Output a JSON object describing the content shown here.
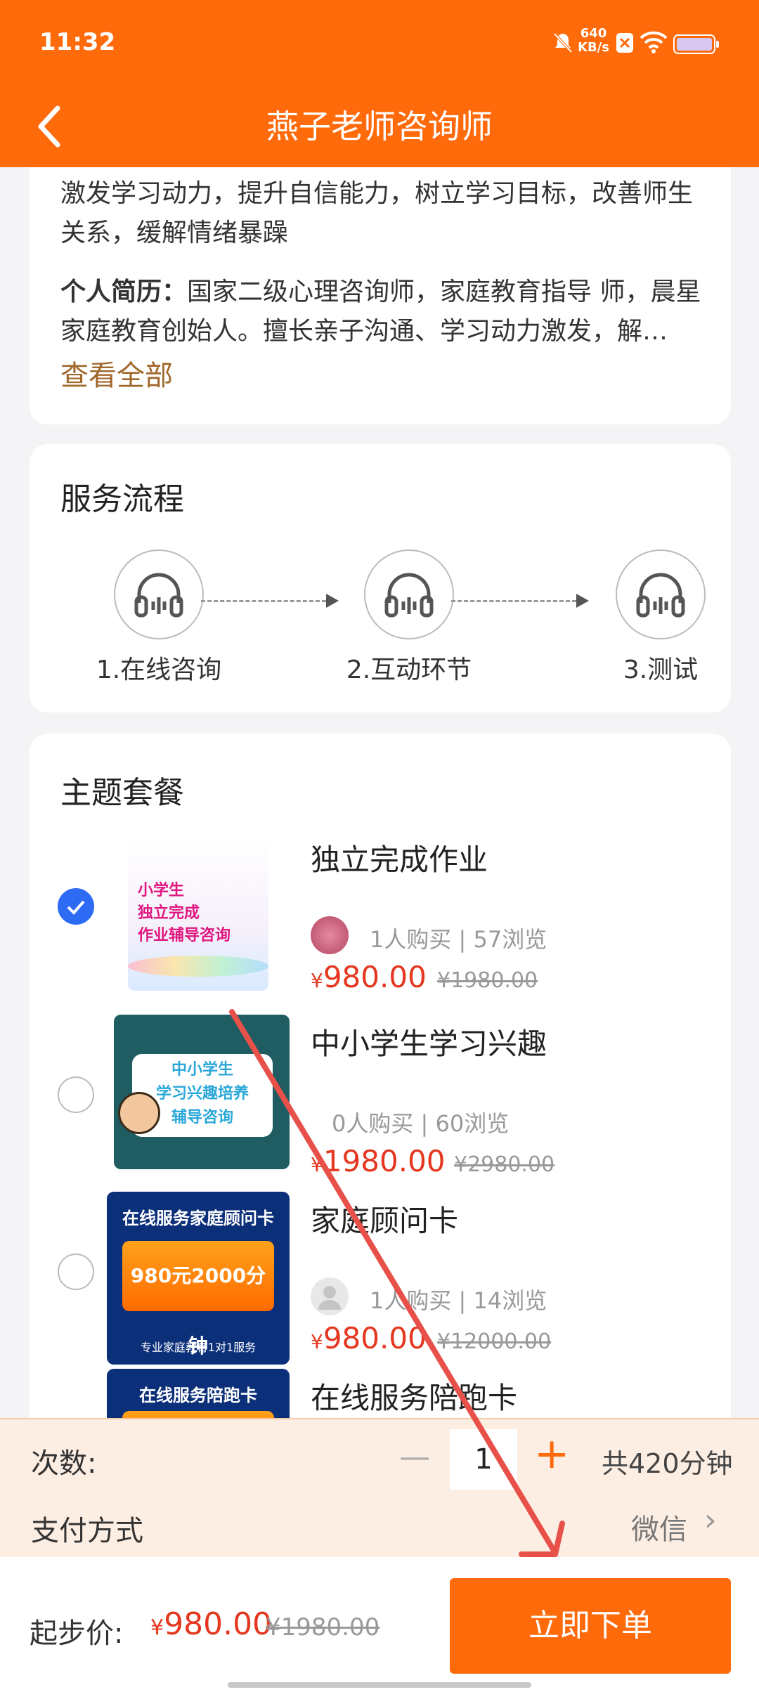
{
  "status_bar": {
    "time": "11:32",
    "speed_value": "640",
    "speed_unit": "KB/s"
  },
  "nav": {
    "title": "燕子老师咨询师"
  },
  "intro": {
    "goal_line": "激发学习动力，提升自信能力，树立学习目标，改善师生关系，缓解情绪暴躁",
    "bio_label": "个人简历：",
    "bio_text": "国家二级心理咨询师，家庭教育指导 师，晨星家庭教育创始人。擅长亲子沟通、学习动力激发，解…",
    "more": "查看全部"
  },
  "service_flow": {
    "title": "服务流程",
    "steps": [
      "1.在线咨询",
      "2.互动环节",
      "3.测试"
    ]
  },
  "packages": {
    "title": "主题套餐",
    "items": [
      {
        "name": "独立完成作业",
        "stats": "1人购买 | 57浏览",
        "currency": "¥",
        "price": "980.00",
        "old_price": "¥1980.00",
        "selected": true,
        "thumb_lines": [
          "小学生",
          "独立完成",
          "作业辅导咨询"
        ]
      },
      {
        "name": "中小学生学习兴趣",
        "stats": "0人购买 | 60浏览",
        "currency": "¥",
        "price": "1980.00",
        "old_price": "¥2980.00",
        "selected": false,
        "thumb_lines": [
          "中小学生",
          "学习兴趣培养",
          "辅导咨询"
        ]
      },
      {
        "name": "家庭顾问卡",
        "stats": "1人购买 | 14浏览",
        "currency": "¥",
        "price": "980.00",
        "old_price": "¥12000.00",
        "selected": false,
        "thumb_lines": [
          "在线服务家庭顾问卡",
          "980元2000分钟",
          "专业家庭教育1对1服务"
        ]
      },
      {
        "name": "在线服务陪跑卡",
        "selected": false,
        "thumb_lines": [
          "在线服务陪跑卡"
        ]
      }
    ]
  },
  "order": {
    "count_label": "次数:",
    "minus": "—",
    "quantity": "1",
    "plus": "+",
    "total": "共420分钟",
    "pay_label": "支付方式",
    "pay_value": "微信",
    "chevron": "›"
  },
  "bottom_bar": {
    "start_label": "起步价:",
    "currency": "¥",
    "price": "980.00",
    "old_price": "¥1980.00",
    "button": "立即下单"
  },
  "colors": {
    "brand": "#ff6a0a",
    "price": "#e5371f",
    "selected": "#2d6bf5",
    "annotation_arrow": "#e8504a"
  }
}
